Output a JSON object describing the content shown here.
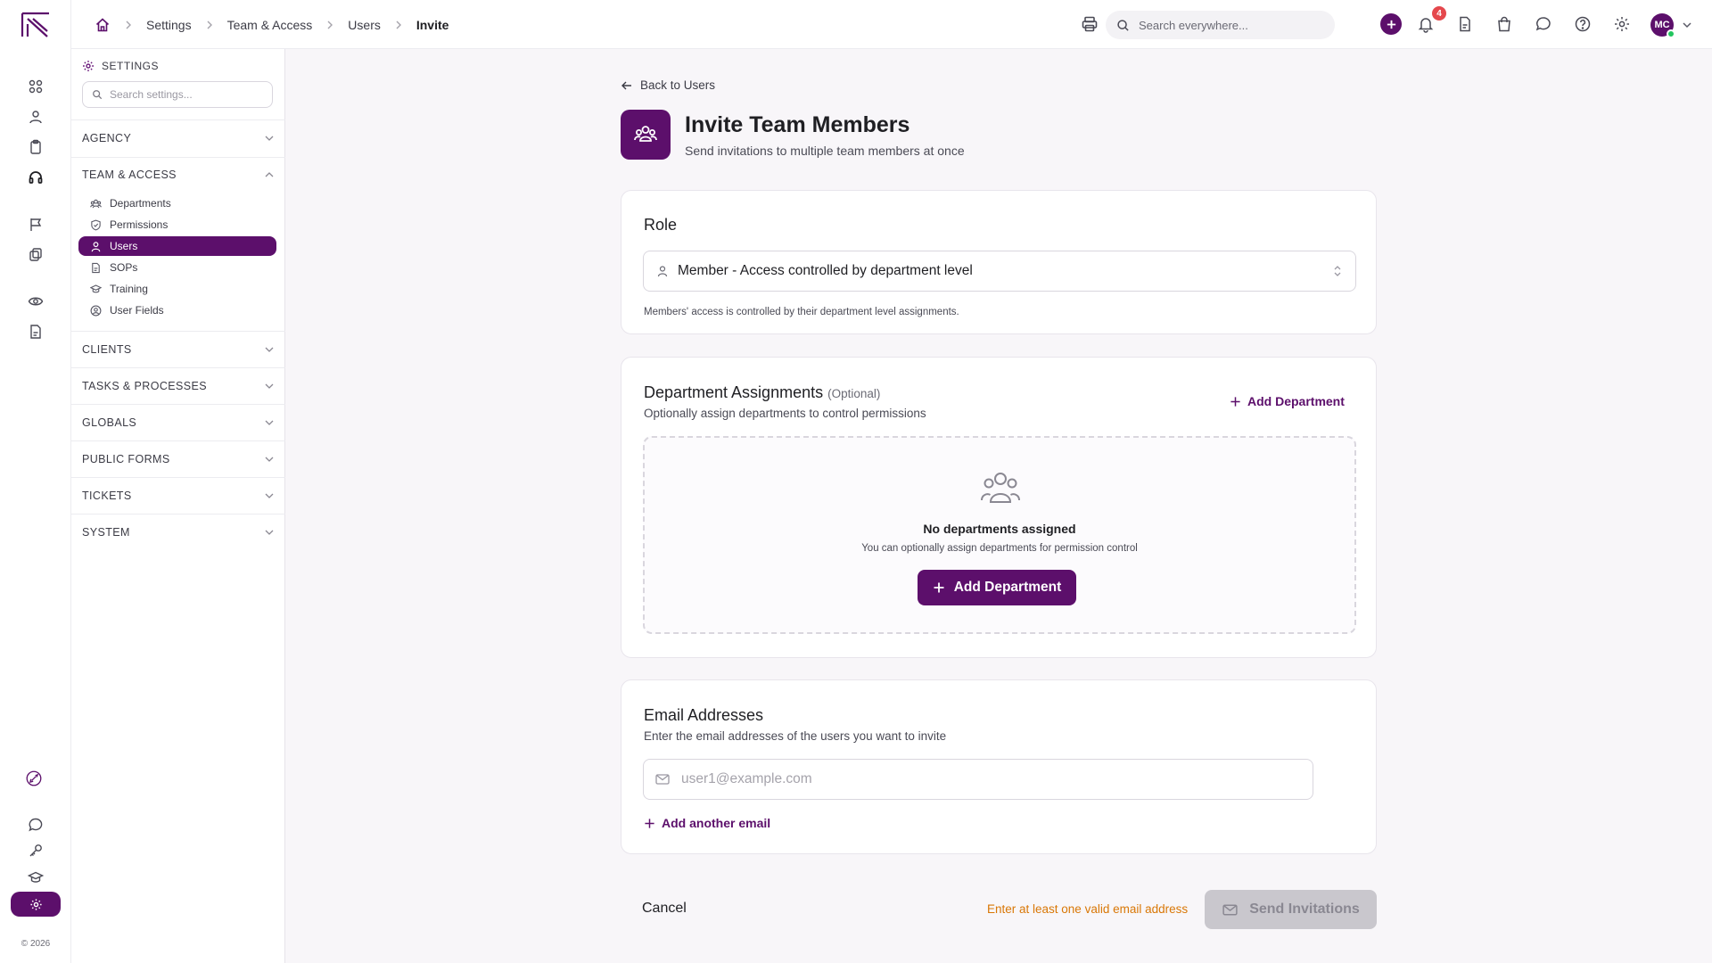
{
  "topbar": {
    "breadcrumbs": [
      "Settings",
      "Team & Access",
      "Users",
      "Invite"
    ],
    "search_placeholder": "Search everywhere...",
    "notification_count": "4",
    "avatar_initials": "MC",
    "icons": [
      "print-icon",
      "plus-icon",
      "bell-icon",
      "document-icon",
      "shopping-bag-icon",
      "chat-icon",
      "help-icon",
      "gear-icon"
    ]
  },
  "rail": {
    "copyright": "© 2026",
    "icons": [
      "grid-icon",
      "user-icon",
      "clipboard-icon",
      "headset-icon",
      "flag-icon",
      "shield-icon",
      "eye-icon",
      "document-icon",
      "rocket-icon",
      "chat-icon",
      "key-icon",
      "graduation-cap-icon",
      "gear-icon"
    ]
  },
  "sidebar": {
    "title": "SETTINGS",
    "search_placeholder": "Search settings...",
    "sections": {
      "agency": "AGENCY",
      "team_access": "TEAM & ACCESS",
      "clients": "CLIENTS",
      "tasks": "TASKS & PROCESSES",
      "globals": "GLOBALS",
      "public_forms": "PUBLIC FORMS",
      "tickets": "TICKETS",
      "system": "SYSTEM"
    },
    "team_items": [
      "Departments",
      "Permissions",
      "Users",
      "SOPs",
      "Training",
      "User Fields"
    ],
    "active_item": "Users"
  },
  "header": {
    "back_label": "Back to Users",
    "title": "Invite Team Members",
    "subtitle": "Send invitations to multiple team members at once"
  },
  "role": {
    "title": "Role",
    "selected": "Member - Access controlled by department level",
    "hint": "Members' access is controlled by their department level assignments."
  },
  "departments": {
    "title": "Department Assignments",
    "optional": "(Optional)",
    "subtitle": "Optionally assign departments to control permissions",
    "add_label": "Add Department",
    "empty_title": "No departments assigned",
    "empty_sub": "You can optionally assign departments for permission control",
    "empty_button": "Add Department"
  },
  "emails": {
    "title": "Email Addresses",
    "subtitle": "Enter the email addresses of the users you want to invite",
    "placeholder": "user1@example.com",
    "add_label": "Add another email"
  },
  "footer": {
    "cancel": "Cancel",
    "warning": "Enter at least one valid email address",
    "send": "Send Invitations"
  },
  "colors": {
    "brand": "#5c0f6b",
    "warning": "#d97706",
    "badge": "#e5484d",
    "online": "#22c55e"
  }
}
